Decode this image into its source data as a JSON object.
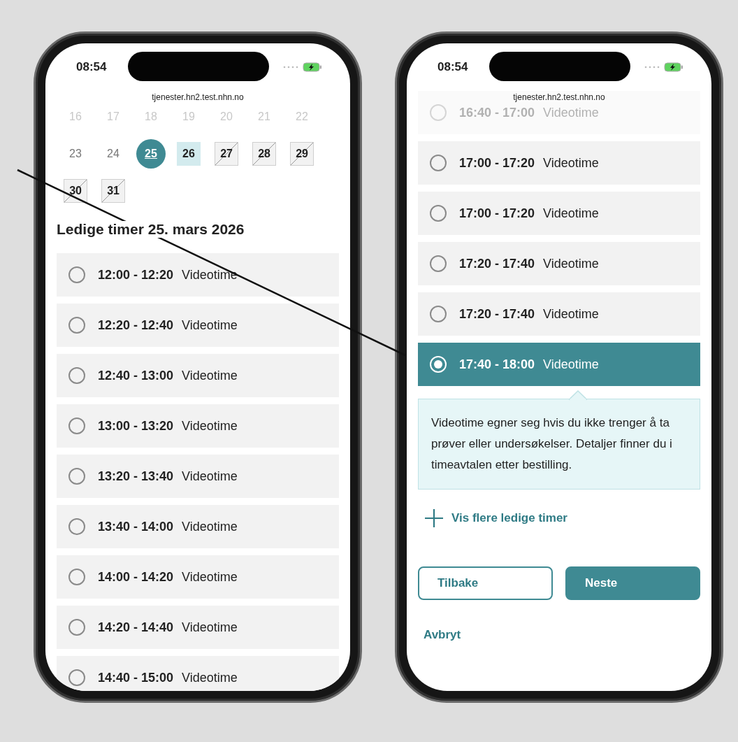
{
  "phones": [
    {
      "status": {
        "time": "08:54"
      },
      "url": "tjenester.hn2.test.nhn.no",
      "calendar": {
        "days": [
          {
            "label": "16",
            "kind": "faded",
            "selected": false
          },
          {
            "label": "17",
            "kind": "faded",
            "selected": false
          },
          {
            "label": "18",
            "kind": "faded",
            "selected": false
          },
          {
            "label": "19",
            "kind": "faded",
            "selected": false
          },
          {
            "label": "20",
            "kind": "faded",
            "selected": false
          },
          {
            "label": "21",
            "kind": "faded",
            "selected": false
          },
          {
            "label": "22",
            "kind": "faded",
            "selected": false
          },
          {
            "label": "23",
            "kind": "past",
            "selected": false
          },
          {
            "label": "24",
            "kind": "past",
            "selected": false
          },
          {
            "label": "25",
            "kind": "available",
            "selected": true
          },
          {
            "label": "26",
            "kind": "available",
            "selected": false
          },
          {
            "label": "27",
            "kind": "unavailable",
            "selected": false
          },
          {
            "label": "28",
            "kind": "unavailable",
            "selected": false
          },
          {
            "label": "29",
            "kind": "unavailable",
            "selected": false
          },
          {
            "label": "30",
            "kind": "unavailable",
            "selected": false
          },
          {
            "label": "31",
            "kind": "unavailable",
            "selected": false
          }
        ]
      },
      "heading": "Ledige timer 25. mars 2026",
      "slots": [
        {
          "time": "12:00 - 12:20",
          "type": "Videotime",
          "selected": false,
          "dimmed": false
        },
        {
          "time": "12:20 - 12:40",
          "type": "Videotime",
          "selected": false,
          "dimmed": false
        },
        {
          "time": "12:40 - 13:00",
          "type": "Videotime",
          "selected": false,
          "dimmed": false
        },
        {
          "time": "13:00 - 13:20",
          "type": "Videotime",
          "selected": false,
          "dimmed": false
        },
        {
          "time": "13:20 - 13:40",
          "type": "Videotime",
          "selected": false,
          "dimmed": false
        },
        {
          "time": "13:40 - 14:00",
          "type": "Videotime",
          "selected": false,
          "dimmed": false
        },
        {
          "time": "14:00 - 14:20",
          "type": "Videotime",
          "selected": false,
          "dimmed": false
        },
        {
          "time": "14:20 - 14:40",
          "type": "Videotime",
          "selected": false,
          "dimmed": false
        },
        {
          "time": "14:40 - 15:00",
          "type": "Videotime",
          "selected": false,
          "dimmed": false
        }
      ]
    },
    {
      "status": {
        "time": "08:54"
      },
      "url": "tjenester.hn2.test.nhn.no",
      "slots": [
        {
          "time": "16:40 - 17:00",
          "type": "Videotime",
          "selected": false,
          "dimmed": true
        },
        {
          "time": "17:00 - 17:20",
          "type": "Videotime",
          "selected": false,
          "dimmed": false
        },
        {
          "time": "17:00 - 17:20",
          "type": "Videotime",
          "selected": false,
          "dimmed": false
        },
        {
          "time": "17:20 - 17:40",
          "type": "Videotime",
          "selected": false,
          "dimmed": false
        },
        {
          "time": "17:20 - 17:40",
          "type": "Videotime",
          "selected": false,
          "dimmed": false
        },
        {
          "time": "17:40 - 18:00",
          "type": "Videotime",
          "selected": true,
          "dimmed": false
        }
      ],
      "info": "Videotime egner seg hvis du ikke trenger å ta prøver eller undersøkelser. Detaljer finner du i timeavtalen etter bestilling.",
      "show_more": "Vis flere ledige timer",
      "buttons": [
        {
          "label": "Tilbake",
          "kind": "secondary"
        },
        {
          "label": "Neste",
          "kind": "primary"
        }
      ],
      "cancel": "Avbryt"
    }
  ]
}
